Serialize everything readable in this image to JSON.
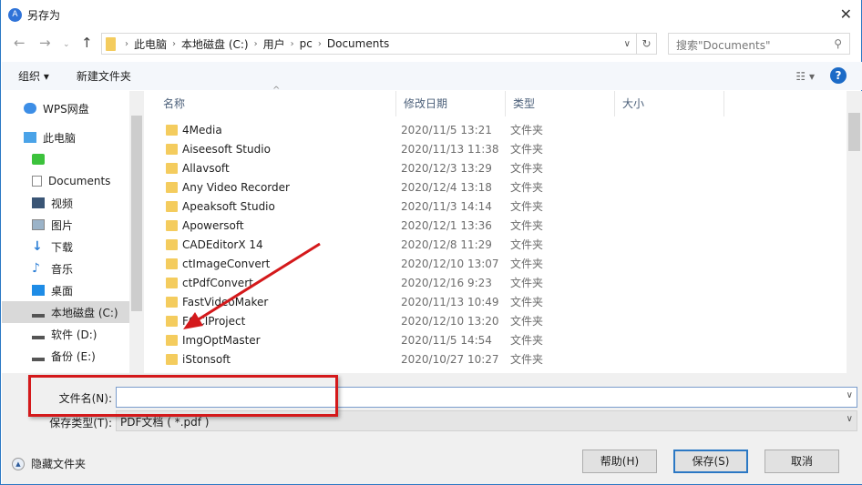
{
  "title": "另存为",
  "address": {
    "crumbs": [
      "此电脑",
      "本地磁盘 (C:)",
      "用户",
      "pc",
      "Documents"
    ]
  },
  "search_placeholder": "搜索\"Documents\"",
  "toolbar": {
    "organize": "组织 ▾",
    "new_folder": "新建文件夹"
  },
  "sidebar": {
    "items": [
      {
        "label": "WPS网盘",
        "icon": "cloud-icon"
      },
      {
        "label": "此电脑",
        "icon": "computer-icon"
      },
      {
        "label": "",
        "icon": "app-icon"
      },
      {
        "label": "Documents",
        "icon": "document-icon"
      },
      {
        "label": "视频",
        "icon": "video-icon"
      },
      {
        "label": "图片",
        "icon": "picture-icon"
      },
      {
        "label": "下载",
        "icon": "download-icon"
      },
      {
        "label": "音乐",
        "icon": "music-icon"
      },
      {
        "label": "桌面",
        "icon": "desktop-icon"
      },
      {
        "label": "本地磁盘 (C:)",
        "icon": "drive-icon",
        "selected": true
      },
      {
        "label": "软件 (D:)",
        "icon": "drive-icon"
      },
      {
        "label": "备份 (E:)",
        "icon": "drive-icon"
      }
    ]
  },
  "columns": [
    "名称",
    "修改日期",
    "类型",
    "大小"
  ],
  "files": [
    {
      "name": "4Media",
      "date": "2020/11/5 13:21",
      "type": "文件夹"
    },
    {
      "name": "Aiseesoft Studio",
      "date": "2020/11/13 11:38",
      "type": "文件夹"
    },
    {
      "name": "Allavsoft",
      "date": "2020/12/3 13:29",
      "type": "文件夹"
    },
    {
      "name": "Any Video Recorder",
      "date": "2020/12/4 13:18",
      "type": "文件夹"
    },
    {
      "name": "Apeaksoft Studio",
      "date": "2020/11/3 14:14",
      "type": "文件夹"
    },
    {
      "name": "Apowersoft",
      "date": "2020/12/1 13:36",
      "type": "文件夹"
    },
    {
      "name": "CADEditorX 14",
      "date": "2020/12/8 11:29",
      "type": "文件夹"
    },
    {
      "name": "ctImageConvert",
      "date": "2020/12/10 13:07",
      "type": "文件夹"
    },
    {
      "name": "ctPdfConvert",
      "date": "2020/12/16 9:23",
      "type": "文件夹"
    },
    {
      "name": "FastVideoMaker",
      "date": "2020/11/13 10:49",
      "type": "文件夹"
    },
    {
      "name": "FOCIProject",
      "date": "2020/12/10 13:20",
      "type": "文件夹"
    },
    {
      "name": "ImgOptMaster",
      "date": "2020/11/5 14:54",
      "type": "文件夹"
    },
    {
      "name": "iStonsoft",
      "date": "2020/10/27 10:27",
      "type": "文件夹"
    }
  ],
  "filename": {
    "label": "文件名(N):",
    "value": ""
  },
  "filetype": {
    "label": "保存类型(T):",
    "value": "PDF文档 ( *.pdf )"
  },
  "hide_folders": "隐藏文件夹",
  "buttons": {
    "help": "帮助(H)",
    "save": "保存(S)",
    "cancel": "取消"
  },
  "accent": "#2b78c4",
  "annotation_color": "#d4191b"
}
